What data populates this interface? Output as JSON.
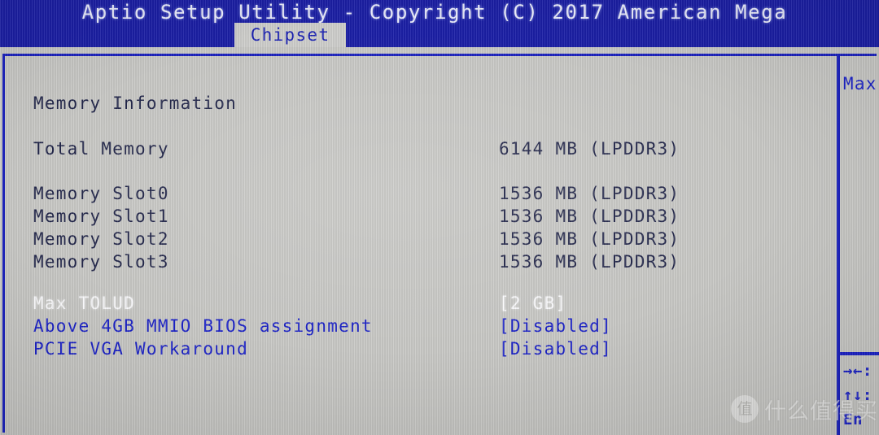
{
  "header": {
    "title": "Aptio Setup Utility - Copyright (C) 2017 American Mega",
    "tab_label": "Chipset"
  },
  "main": {
    "section_heading": "Memory Information",
    "rows": [
      {
        "label": "Total Memory",
        "value": "6144 MB (LPDDR3)",
        "style": "info",
        "interactable": false
      },
      {
        "label": "Memory Slot0",
        "value": "1536 MB (LPDDR3)",
        "style": "info",
        "interactable": false
      },
      {
        "label": "Memory Slot1",
        "value": "1536 MB (LPDDR3)",
        "style": "info",
        "interactable": false
      },
      {
        "label": "Memory Slot2",
        "value": "1536 MB (LPDDR3)",
        "style": "info",
        "interactable": false
      },
      {
        "label": "Memory Slot3",
        "value": "1536 MB (LPDDR3)",
        "style": "info",
        "interactable": false
      },
      {
        "label": "Max TOLUD",
        "value": "[2 GB]",
        "style": "sel",
        "interactable": true
      },
      {
        "label": "Above 4GB MMIO BIOS assignment",
        "value": "[Disabled]",
        "style": "opt",
        "interactable": true
      },
      {
        "label": "PCIE VGA Workaround",
        "value": "[Disabled]",
        "style": "opt",
        "interactable": true
      }
    ]
  },
  "help": {
    "text": "Max",
    "hints": [
      "→←:",
      "↑↓:",
      "En"
    ]
  },
  "watermark": {
    "badge": "值",
    "text": "什么值得买"
  },
  "colors": {
    "header_blue": "#1b1fa6",
    "border_blue": "#1b22c0",
    "option_blue": "#1b22c8",
    "info_navy": "#22264a",
    "selected_white": "#fbfbfd",
    "screen_gray": "#c9c9c6",
    "tab_gray": "#cfcfcc"
  }
}
